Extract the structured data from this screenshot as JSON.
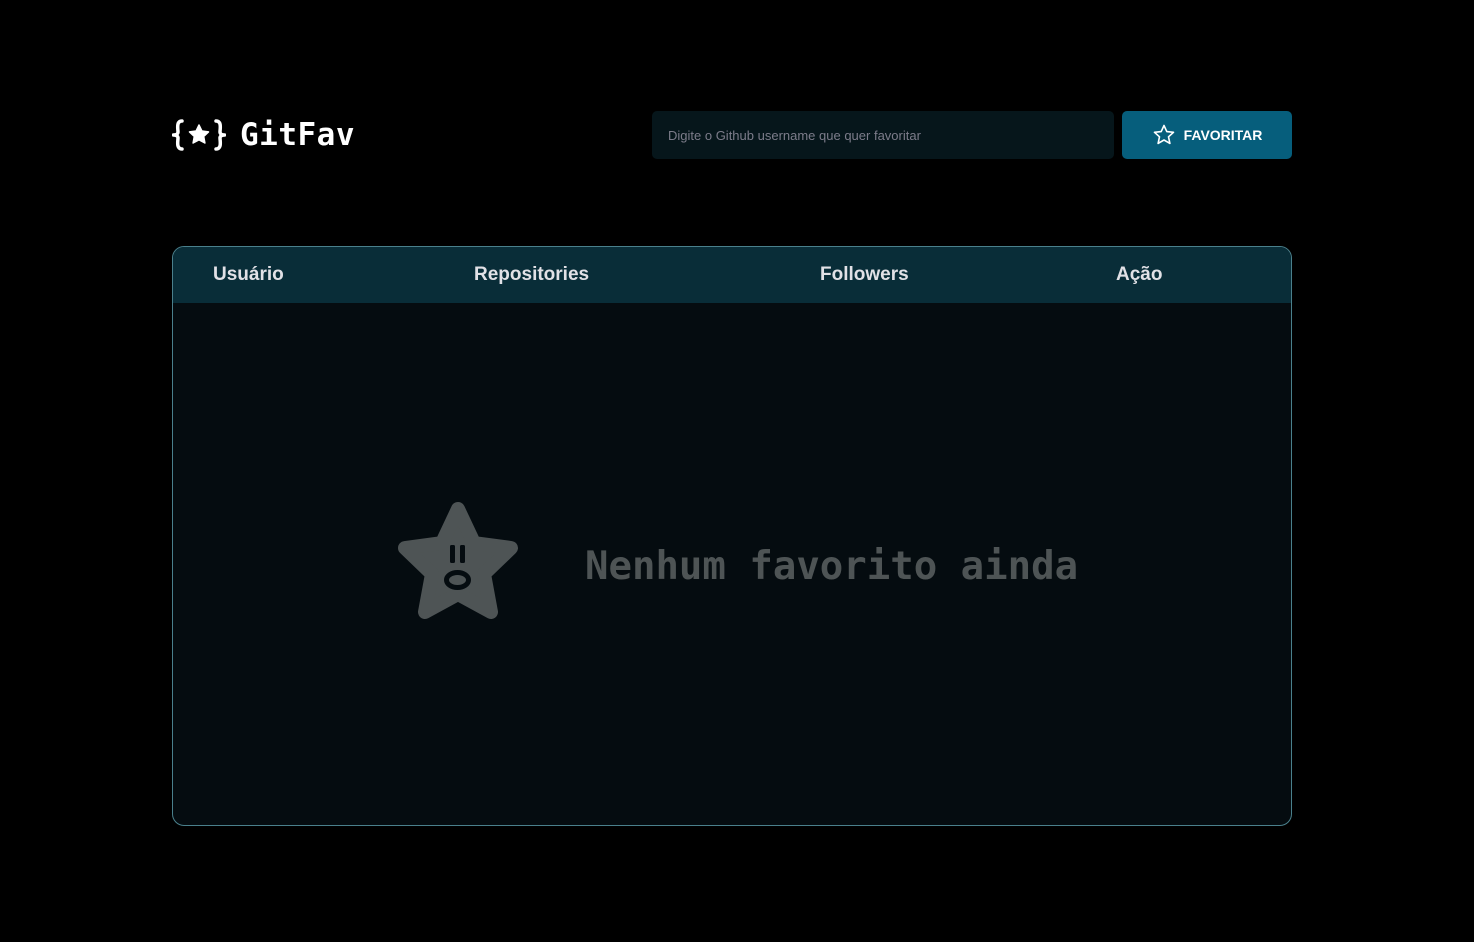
{
  "app": {
    "title": "GitFav",
    "logo_icon": "star-braces-icon"
  },
  "search": {
    "placeholder": "Digite o Github username que quer favoritar",
    "value": ""
  },
  "favorite_button": {
    "label": "FAVORITAR",
    "icon": "star-outline-icon"
  },
  "table": {
    "columns": [
      "Usuário",
      "Repositories",
      "Followers",
      "Ação"
    ],
    "rows": []
  },
  "empty_state": {
    "message": "Nenhum favorito ainda",
    "icon": "surprised-star-icon"
  },
  "colors": {
    "background": "#000000",
    "accent": "#065e7c",
    "table_header": "#092d38",
    "table_body": "#050c10",
    "border": "#4a808c",
    "empty_text": "#4e5455"
  }
}
